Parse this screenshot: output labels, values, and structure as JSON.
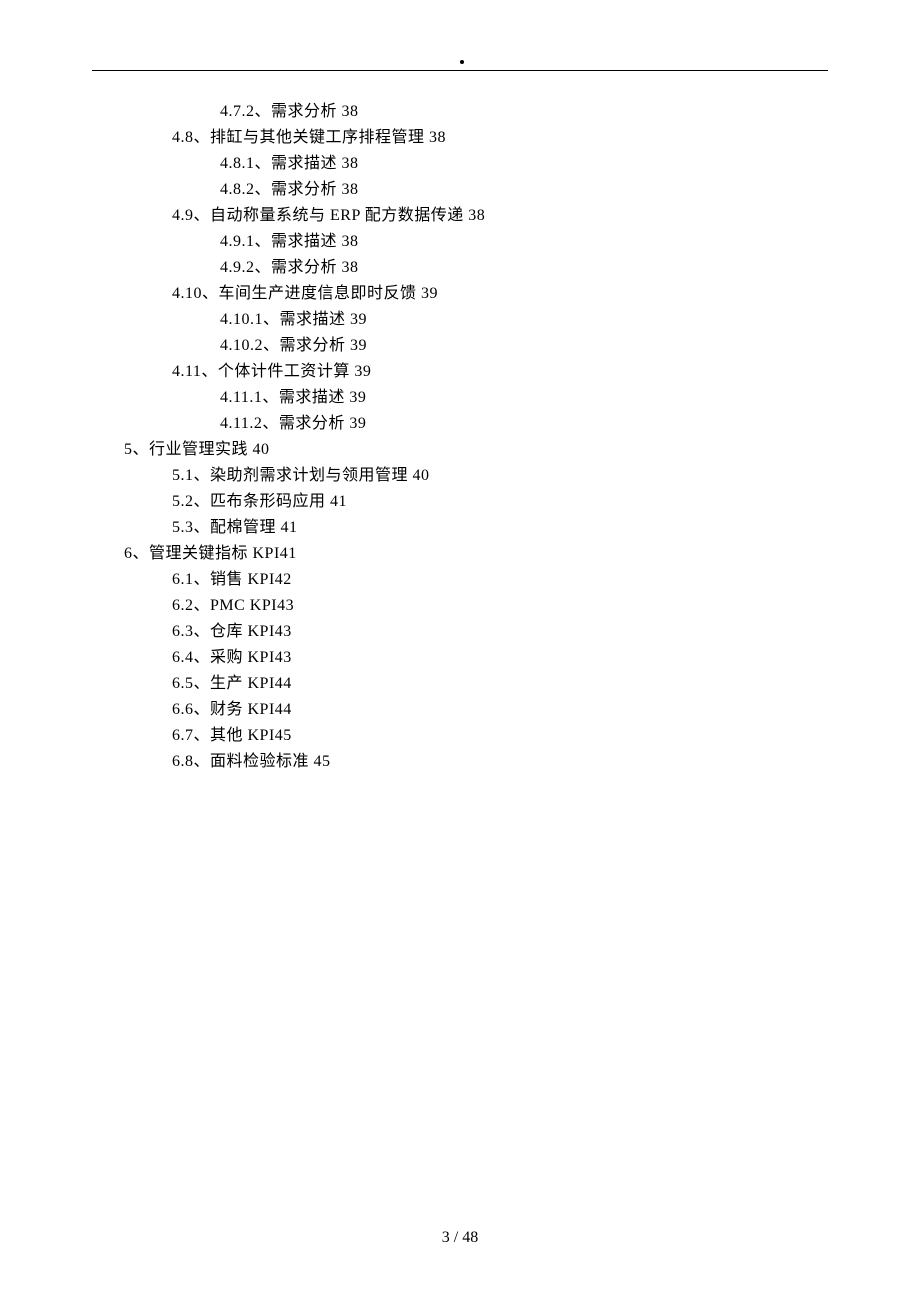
{
  "toc": [
    {
      "level": 3,
      "text": "4.7.2、需求分析 38"
    },
    {
      "level": 2,
      "text": "4.8、排缸与其他关键工序排程管理 38"
    },
    {
      "level": 3,
      "text": "4.8.1、需求描述 38"
    },
    {
      "level": 3,
      "text": "4.8.2、需求分析 38"
    },
    {
      "level": 2,
      "text": "4.9、自动称量系统与 ERP 配方数据传递 38"
    },
    {
      "level": 3,
      "text": "4.9.1、需求描述 38"
    },
    {
      "level": 3,
      "text": "4.9.2、需求分析 38"
    },
    {
      "level": 2,
      "text": "4.10、车间生产进度信息即时反馈 39"
    },
    {
      "level": 3,
      "text": "4.10.1、需求描述 39"
    },
    {
      "level": 3,
      "text": "4.10.2、需求分析 39"
    },
    {
      "level": 2,
      "text": "4.11、个体计件工资计算 39"
    },
    {
      "level": 3,
      "text": "4.11.1、需求描述 39"
    },
    {
      "level": 3,
      "text": "4.11.2、需求分析 39"
    },
    {
      "level": 1,
      "text": "5、行业管理实践 40"
    },
    {
      "level": 2,
      "text": "5.1、染助剂需求计划与领用管理 40"
    },
    {
      "level": 2,
      "text": "5.2、匹布条形码应用 41"
    },
    {
      "level": 2,
      "text": "5.3、配棉管理 41"
    },
    {
      "level": 1,
      "text": "6、管理关键指标 KPI41"
    },
    {
      "level": 2,
      "text": "6.1、销售 KPI42"
    },
    {
      "level": 2,
      "text": "6.2、PMC KPI43"
    },
    {
      "level": 2,
      "text": "6.3、仓库 KPI43"
    },
    {
      "level": 2,
      "text": "6.4、采购 KPI43"
    },
    {
      "level": 2,
      "text": "6.5、生产 KPI44"
    },
    {
      "level": 2,
      "text": "6.6、财务 KPI44"
    },
    {
      "level": 2,
      "text": "6.7、其他 KPI45"
    },
    {
      "level": 2,
      "text": "6.8、面料检验标准 45"
    }
  ],
  "footer": "3 / 48"
}
